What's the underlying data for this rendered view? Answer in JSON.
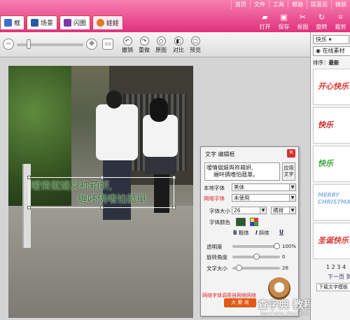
{
  "menubar": [
    "首页",
    "文件",
    "工具",
    "帮助",
    "提意见",
    "换肤"
  ],
  "tabs": [
    {
      "label": "框",
      "color": "#3a6fd0"
    },
    {
      "label": "场景",
      "color": "#2a5aa8"
    },
    {
      "label": "闪图",
      "color": "#7a3aa8"
    },
    {
      "label": "娃娃",
      "color": "#e07a20"
    }
  ],
  "toolbar_right": [
    {
      "label": "打开",
      "icon": "folder-icon"
    },
    {
      "label": "保存",
      "icon": "save-icon"
    },
    {
      "label": "抠图",
      "icon": "scissors-icon"
    },
    {
      "label": "旋转",
      "icon": "rotate-icon"
    },
    {
      "label": "裁剪",
      "icon": "crop-icon"
    }
  ],
  "edit_buttons": [
    {
      "label": "撤销",
      "icon": "undo-icon"
    },
    {
      "label": "重做",
      "icon": "redo-icon"
    },
    {
      "label": "原图",
      "icon": "original-icon"
    },
    {
      "label": "对比",
      "icon": "compare-icon"
    },
    {
      "label": "预览",
      "icon": "preview-icon"
    }
  ],
  "overlay_text": {
    "line1": "嗳情僦媞與祢葙姸,",
    "line2": "緾吥俩嗜怕菰單"
  },
  "dialog": {
    "title": "文字 编辑框",
    "close": "×",
    "textarea": "嗳情僦媞與祢葙姸,\n    緾吥俩嗜怕菰單。",
    "apply": "应用\n文字",
    "local_font_label": "本地字体",
    "local_font_value": "黑体",
    "web_font_label": "网络字体",
    "web_font_value": "未使用",
    "size_label": "字体大小",
    "size_value": "26",
    "orientation_value": "横排",
    "color_label": "字体颜色",
    "bold": "粗体",
    "italic": "斜体",
    "underline": "U",
    "opacity_label": "透明度",
    "opacity_value": "100%",
    "opacity": 1.0,
    "rotation_label": "旋转角度",
    "rotation_value": "0",
    "text_size_label": "文字大小",
    "text_size_value": "26",
    "footer": "网络字体调用自网络网络"
  },
  "watermark": {
    "badge": "大 聚 尚",
    "title": "查字典 教程网",
    "url": "jiaocheng.chazidian.com"
  },
  "right_panel": {
    "category": "快乐",
    "tab": "在线素材",
    "sort_label": "排序：",
    "sort_value": "最新",
    "thumbs": [
      {
        "text": "开心快乐",
        "color": "#e0302a"
      },
      {
        "text": "快乐",
        "color": "#d22"
      },
      {
        "text": "快乐",
        "color": "#3a3"
      },
      {
        "text": "MERRY CHRISTMAS",
        "color": "#8fb8e8"
      },
      {
        "text": "圣诞快乐",
        "color": "#d33"
      }
    ],
    "pages": "1 2 3 4",
    "next": "下一页 到",
    "download": "下载文字模板"
  }
}
